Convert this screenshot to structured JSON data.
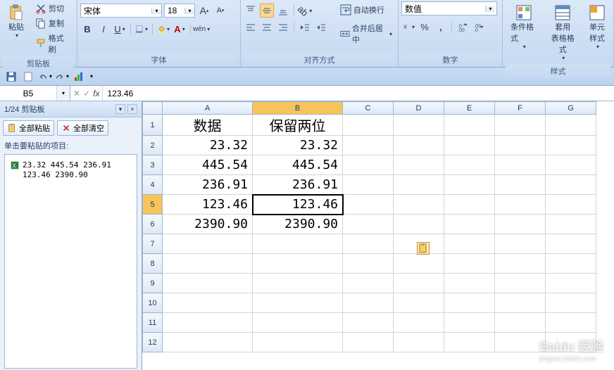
{
  "ribbon": {
    "clipboard": {
      "label": "剪贴板",
      "paste": "粘贴",
      "cut": "剪切",
      "copy": "复制",
      "format_painter": "格式刷"
    },
    "font": {
      "label": "字体",
      "name": "宋体",
      "size": "18",
      "inc": "A",
      "dec": "A"
    },
    "align": {
      "label": "对齐方式",
      "wrap": "自动换行",
      "merge": "合并后居中"
    },
    "number": {
      "label": "数字",
      "format": "数值"
    },
    "styles": {
      "label": "样式",
      "cond": "条件格式",
      "tbl": "套用\n表格格式",
      "cell": "单元\n样式"
    }
  },
  "formula_bar": {
    "cell_ref": "B5",
    "formula": "123.46"
  },
  "clipboard_pane": {
    "title": "剪贴板",
    "counter": "1/24",
    "paste_all": "全部粘贴",
    "clear_all": "全部清空",
    "hint": "单击要粘贴的项目:",
    "items": [
      {
        "text": "23.32 445.54 236.91 123.46 2390.90"
      }
    ]
  },
  "sheet": {
    "columns": [
      "A",
      "B",
      "C",
      "D",
      "E",
      "F",
      "G"
    ],
    "rows": [
      {
        "n": 1,
        "cells": [
          "数据",
          "保留两位",
          "",
          "",
          "",
          "",
          ""
        ]
      },
      {
        "n": 2,
        "cells": [
          "23.32",
          "23.32",
          "",
          "",
          "",
          "",
          ""
        ]
      },
      {
        "n": 3,
        "cells": [
          "445.54",
          "445.54",
          "",
          "",
          "",
          "",
          ""
        ]
      },
      {
        "n": 4,
        "cells": [
          "236.91",
          "236.91",
          "",
          "",
          "",
          "",
          ""
        ]
      },
      {
        "n": 5,
        "cells": [
          "123.46",
          "123.46",
          "",
          "",
          "",
          "",
          ""
        ]
      },
      {
        "n": 6,
        "cells": [
          "2390.90",
          "2390.90",
          "",
          "",
          "",
          "",
          ""
        ]
      },
      {
        "n": 7,
        "cells": [
          "",
          "",
          "",
          "",
          "",
          "",
          ""
        ]
      },
      {
        "n": 8,
        "cells": [
          "",
          "",
          "",
          "",
          "",
          "",
          ""
        ]
      },
      {
        "n": 9,
        "cells": [
          "",
          "",
          "",
          "",
          "",
          "",
          ""
        ]
      },
      {
        "n": 10,
        "cells": [
          "",
          "",
          "",
          "",
          "",
          "",
          ""
        ]
      },
      {
        "n": 11,
        "cells": [
          "",
          "",
          "",
          "",
          "",
          "",
          ""
        ]
      },
      {
        "n": 12,
        "cells": [
          "",
          "",
          "",
          "",
          "",
          "",
          ""
        ]
      }
    ],
    "active_cell": "B5",
    "active_row": 5,
    "active_col": "B"
  },
  "watermark": {
    "main": "Baidu 经验",
    "sub": "jingyan.baidu.com"
  }
}
